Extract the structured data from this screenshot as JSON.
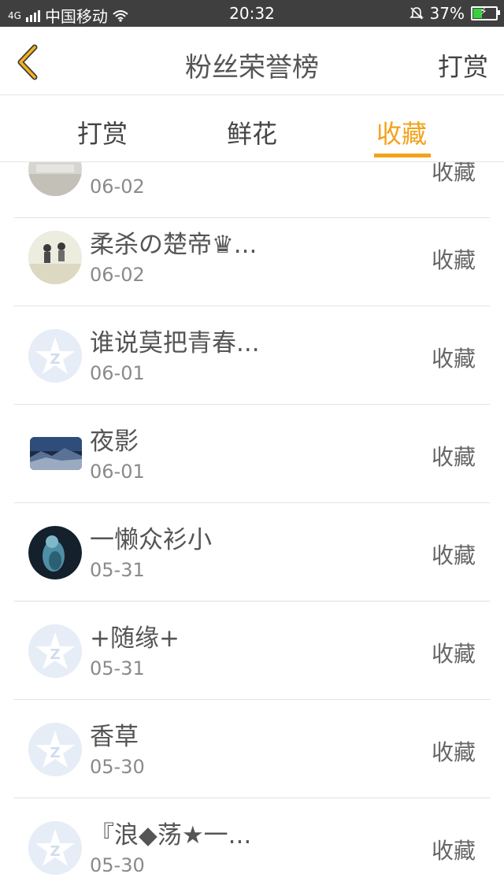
{
  "status_bar": {
    "carrier": "中国移动",
    "time": "20:32",
    "battery_percent": "37%",
    "network": "4G"
  },
  "header": {
    "title": "粉丝荣誉榜",
    "action": "打赏"
  },
  "tabs": [
    {
      "label": "打赏",
      "active": false
    },
    {
      "label": "鲜花",
      "active": false
    },
    {
      "label": "收藏",
      "active": true
    }
  ],
  "list": {
    "items": [
      {
        "name": "",
        "date": "06-02",
        "action": "收藏",
        "avatar": "photo-gray"
      },
      {
        "name": "柔杀の楚帝♛...",
        "date": "06-02",
        "action": "收藏",
        "avatar": "photo-people"
      },
      {
        "name": "谁说莫把青春...",
        "date": "06-01",
        "action": "收藏",
        "avatar": "default-qq-icon"
      },
      {
        "name": "夜影",
        "date": "06-01",
        "action": "收藏",
        "avatar": "photo-landscape"
      },
      {
        "name": "一懒众衫小",
        "date": "05-31",
        "action": "收藏",
        "avatar": "photo-dark"
      },
      {
        "name": "+随缘+",
        "date": "05-31",
        "action": "收藏",
        "avatar": "default-qq-icon"
      },
      {
        "name": "香草",
        "date": "05-30",
        "action": "收藏",
        "avatar": "default-qq-icon"
      },
      {
        "name": "『浪◆荡★一...",
        "date": "05-30",
        "action": "收藏",
        "avatar": "default-qq-icon"
      }
    ]
  },
  "colors": {
    "accent": "#f3a21a",
    "status_bar": "#3f3f3f",
    "divider": "#e2e2e2"
  }
}
